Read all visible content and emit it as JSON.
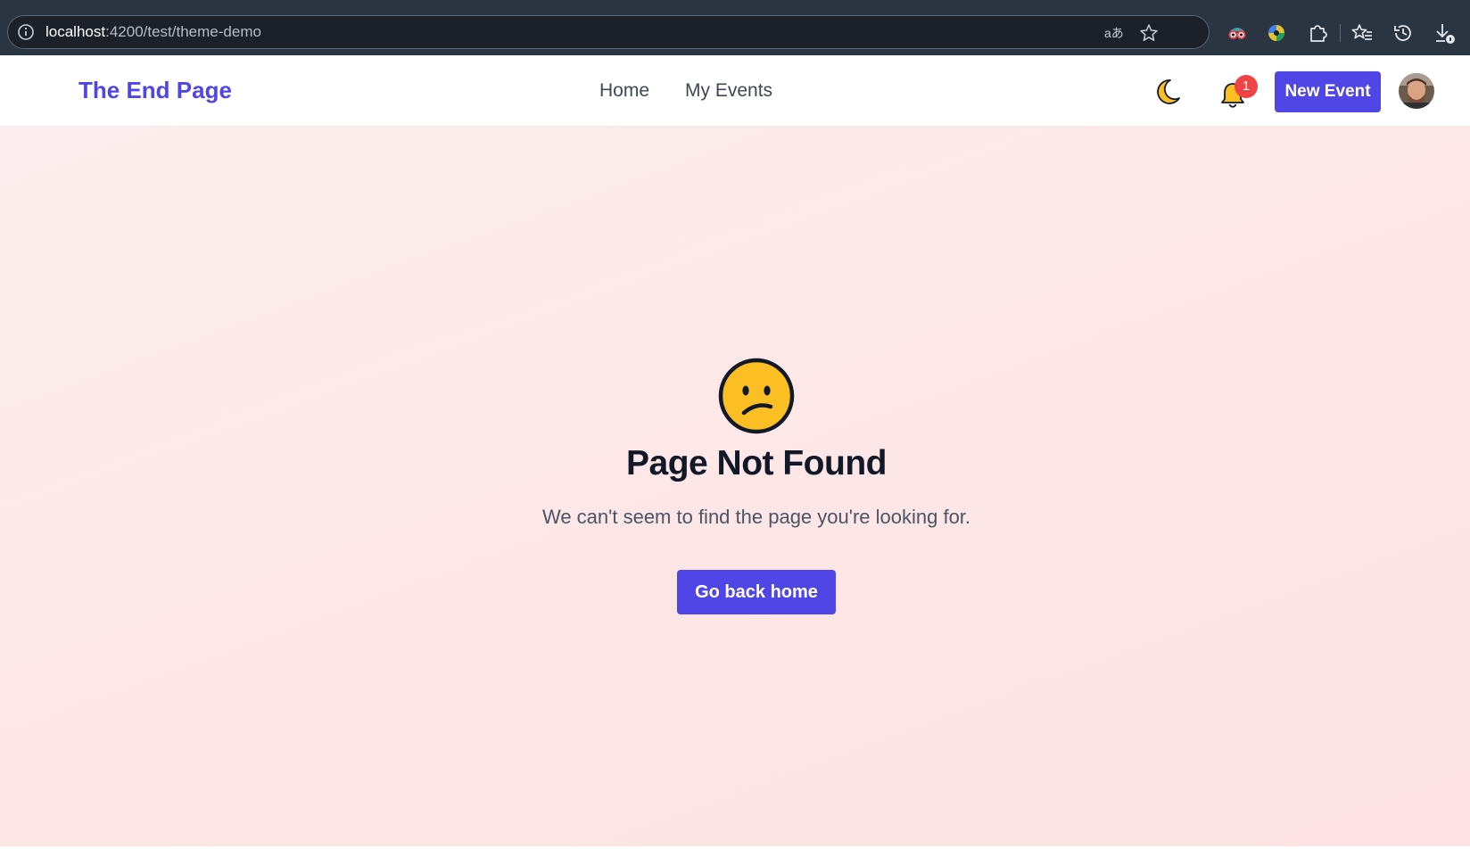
{
  "browser": {
    "url_host": "localhost",
    "url_rest": ":4200/test/theme-demo",
    "icons": [
      "info-icon",
      "translate-icon",
      "bookmark-star-icon",
      "extension-glasses-icon",
      "extension-color-icon",
      "extensions-puzzle-icon",
      "favorites-icon",
      "history-icon",
      "downloads-icon"
    ]
  },
  "navbar": {
    "brand": "The End Page",
    "links": [
      "Home",
      "My Events"
    ],
    "notification_count": "1",
    "new_event_label": "New Event"
  },
  "not_found": {
    "title": "Page Not Found",
    "message": "We can't seem to find the page you're looking for.",
    "button_label": "Go back home"
  },
  "colors": {
    "brand": "#4f46e5",
    "badge": "#ef4444",
    "emoji": "#fbbf24",
    "background": "#fde8e8"
  }
}
